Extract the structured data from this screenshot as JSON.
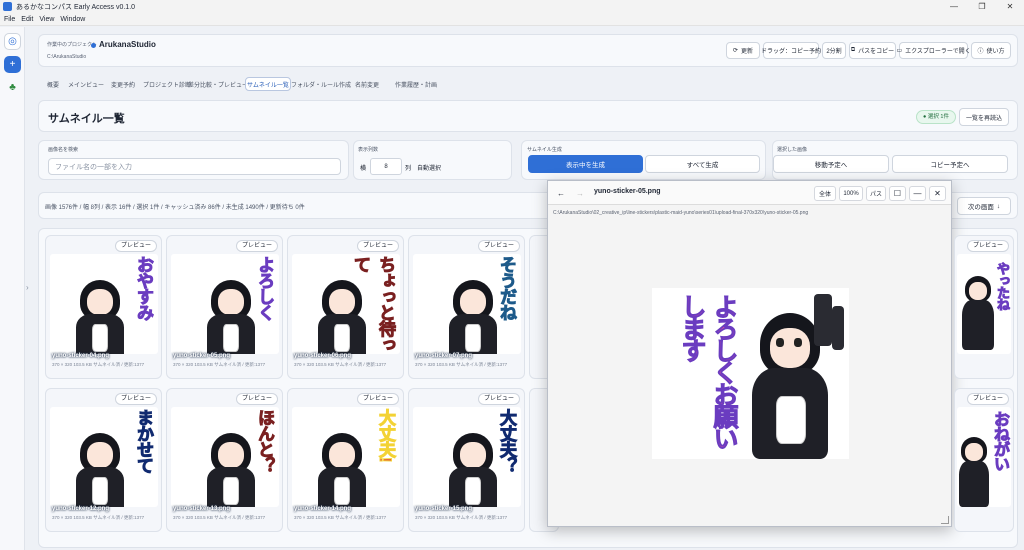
{
  "window": {
    "title": "あるかなコンパス Early Access v0.1.0"
  },
  "menu": [
    "File",
    "Edit",
    "View",
    "Window"
  ],
  "project": {
    "label": "作業中のプロジェクト",
    "name": "ArukanaStudio",
    "path": "C:\\ArukanaStudio"
  },
  "header_buttons": {
    "refresh": "更新",
    "drag": "ドラッグ：コピー予約",
    "split": "2分割",
    "copy_path": "パスをコピー",
    "explorer": "エクスプローラーで開く",
    "help": "使い方"
  },
  "tabs": [
    "概要",
    "メインビュー",
    "変更予約",
    "プロジェクト診断",
    "差分比較・プレビュー",
    "サムネイル一覧",
    "フォルダ・ルール作成",
    "名前変更",
    "作業履歴・計画"
  ],
  "page": {
    "title": "サムネイル一覧",
    "selected_badge": "選択 1件",
    "reload": "一覧を再読込"
  },
  "search": {
    "label": "画像名を検索",
    "placeholder": "ファイル名の一部を入力"
  },
  "columns": {
    "label": "表示列数",
    "prefix": "横",
    "value": "8",
    "suffix": "列",
    "auto": "自動選択"
  },
  "generate": {
    "label": "サムネイル生成",
    "primary": "表示中を生成",
    "all": "すべて生成"
  },
  "selection": {
    "label": "選択した画像",
    "move": "移動予定へ",
    "copy": "コピー予定へ"
  },
  "stats": "画像 1576件 / 幅 8列 / 表示 16件 / 選択 1件 / キャッシュ済み 86件 / 未生成 1490件 / 更新待ち 0件",
  "next_page": "次の画面",
  "preview_label": "プレビュー",
  "thumbs_row1": [
    {
      "name": "yuno-sticker-04.png",
      "text": "おやすみ",
      "meta": "370 × 320  103.5 KB  サムネイル済 / 更新:1377"
    },
    {
      "name": "yuno-sticker-05.png",
      "text": "よろしく",
      "meta": "370 × 320  103.5 KB  サムネイル済 / 更新:1377"
    },
    {
      "name": "yuno-sticker-06.png",
      "text": "ちょっと待って",
      "meta": "370 × 320  103.5 KB  サムネイル済 / 更新:1377"
    },
    {
      "name": "yuno-sticker-07.png",
      "text": "そうだね",
      "meta": "370 × 320  103.5 KB  サムネイル済 / 更新:1377"
    }
  ],
  "thumbs_row2": [
    {
      "name": "yuno-sticker-12.png",
      "text": "まかせて",
      "meta": "370 × 320  103.5 KB  サムネイル済 / 更新:1377"
    },
    {
      "name": "yuno-sticker-13.png",
      "text": "ほんと？",
      "meta": "370 × 320  103.5 KB  サムネイル済 / 更新:1377"
    },
    {
      "name": "yuno-sticker-14.png",
      "text": "大丈夫!",
      "meta": "370 × 320  103.5 KB  サムネイル済 / 更新:1377"
    },
    {
      "name": "yuno-sticker-15.png",
      "text": "大丈夫？",
      "meta": "370 × 320  103.5 KB  サムネイル済 / 更新:1377"
    }
  ],
  "right_thumbs": [
    {
      "text": "やったね"
    },
    {
      "text": "おねがい"
    }
  ],
  "viewer": {
    "filename": "yuno-sticker-05.png",
    "path": "C:\\ArukanaStudio\\02_creative_ip\\line-stickers\\plastic-maid-yuno\\series01\\upload-final-370x320\\yuno-sticker-05.png",
    "fit": "全体",
    "zoom": "100%",
    "copy_path": "パス",
    "sticker_text": "よろしくお願いします"
  },
  "colors": {
    "accent": "#2f6fd6",
    "sticker_purple": "#6a3cc0",
    "sticker_pink": "#e24a9a"
  }
}
